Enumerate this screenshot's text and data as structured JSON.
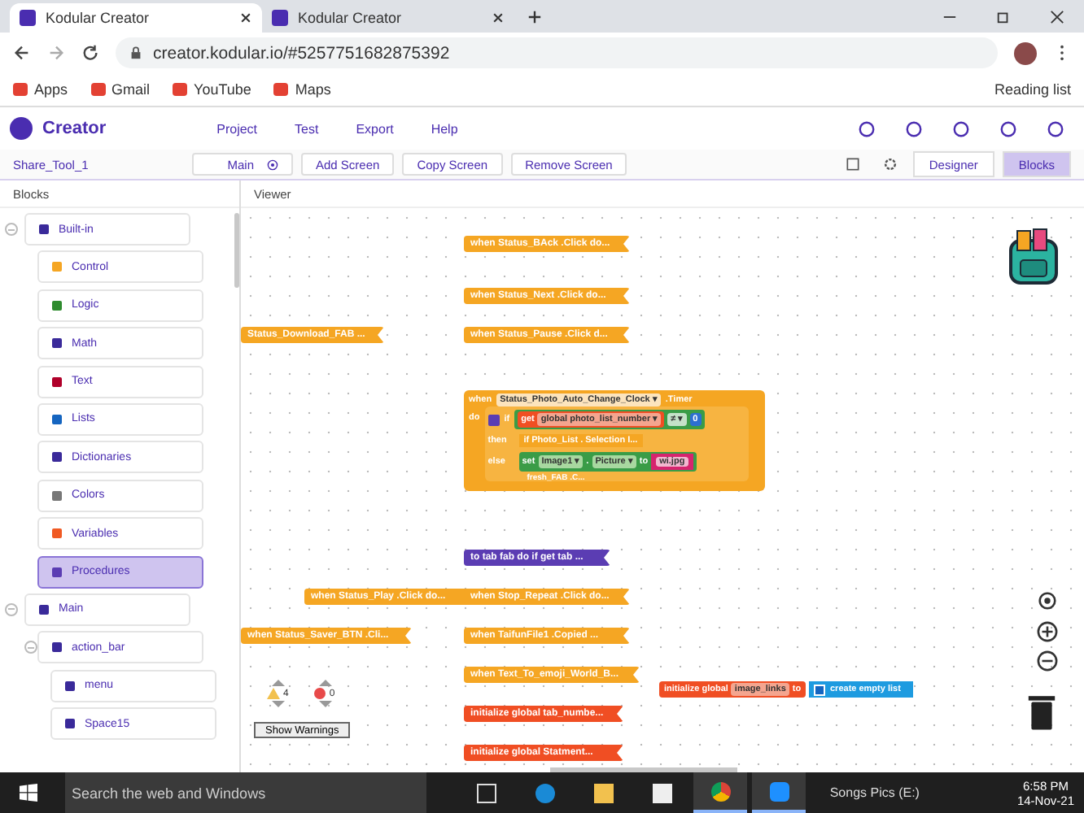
{
  "browser": {
    "tabs": [
      {
        "title": "Kodular Creator",
        "selected": true
      },
      {
        "title": "Kodular Creator",
        "selected": false
      }
    ],
    "url": "creator.kodular.io/#5257751682875392",
    "bookmarks": [
      "Apps",
      "Gmail",
      "YouTube",
      "Maps"
    ],
    "reading_list": "Reading list"
  },
  "app": {
    "logo": "Creator",
    "menu": [
      "Project",
      "Test",
      "Export",
      "Help"
    ]
  },
  "toolbar": {
    "project": "Share_Tool_1",
    "screen": "Main",
    "actions": [
      "Add Screen",
      "Copy Screen",
      "Remove Screen"
    ],
    "views": [
      {
        "label": "Designer",
        "selected": false
      },
      {
        "label": "Blocks",
        "selected": true
      }
    ]
  },
  "blocks_panel": {
    "title": "Blocks",
    "tree": [
      {
        "label": "Built-in",
        "expanded": true,
        "selected": false,
        "children": [
          {
            "label": "Control",
            "selected": false
          },
          {
            "label": "Logic",
            "selected": false
          },
          {
            "label": "Math",
            "selected": false
          },
          {
            "label": "Text",
            "selected": false
          },
          {
            "label": "Lists",
            "selected": false
          },
          {
            "label": "Dictionaries",
            "selected": false
          },
          {
            "label": "Colors",
            "selected": false
          },
          {
            "label": "Variables",
            "selected": false
          },
          {
            "label": "Procedures",
            "selected": true
          }
        ]
      },
      {
        "label": "Main",
        "expanded": true,
        "selected": false,
        "children": [
          {
            "label": "action_bar",
            "expanded": true,
            "selected": false,
            "children": [
              {
                "label": "menu",
                "selected": false
              },
              {
                "label": "Space15",
                "selected": false
              }
            ]
          }
        ]
      }
    ]
  },
  "viewer": {
    "title": "Viewer",
    "blocks": [
      {
        "text": "when  Status_BAck .Click do...",
        "color": "#f5a623"
      },
      {
        "text": "when  Status_Next .Click do...",
        "color": "#f5a623"
      },
      {
        "text": "Status_Download_FAB ...",
        "color": "#f5a623"
      },
      {
        "text": "when  Status_Pause .Click d...",
        "color": "#f5a623"
      },
      {
        "text": "to tab   fab do if get tab ...",
        "color": "#5b3db3"
      },
      {
        "text": "when  Status_Play .Click do...",
        "color": "#f5a623"
      },
      {
        "text": "when  Stop_Repeat .Click do...",
        "color": "#f5a623"
      },
      {
        "text": "when  Status_Saver_BTN .Cli...",
        "color": "#f5a623"
      },
      {
        "text": "when  TaifunFile1 .Copied  ...",
        "color": "#f5a623"
      },
      {
        "text": "when  Text_To_emoji_World_B...",
        "color": "#f5a623"
      },
      {
        "text": "initialize global tab_numbe...",
        "color": "#f04e23"
      },
      {
        "text": "initialize global Statment...",
        "color": "#f04e23"
      }
    ],
    "timer_block": {
      "when": "when",
      "component": "Status_Photo_Auto_Change_Clock ▾",
      "event": ".Timer",
      "do": "do",
      "if": "if",
      "get": "get",
      "variable": "global photo_list_number ▾",
      "operator": "≠ ▾",
      "number": "0",
      "then": "then",
      "then_block": "if Photo_List . Selection I...",
      "else": "else",
      "set": "set",
      "target": "Image1 ▾",
      "dot": ".",
      "property": "Picture ▾",
      "to": "to",
      "string": "wi.jpg",
      "below": "fresh_FAB .C..."
    },
    "init_block": {
      "label": "initialize global",
      "name": "image_links",
      "to": "to",
      "list": "create empty list"
    },
    "warnings": "4",
    "errors": "0",
    "show_warnings": "Show Warnings"
  },
  "taskbar": {
    "search_placeholder": "Search the web and Windows",
    "drive": "Songs Pics  (E:)",
    "time": "6:58 PM",
    "date": "14-Nov-21"
  }
}
